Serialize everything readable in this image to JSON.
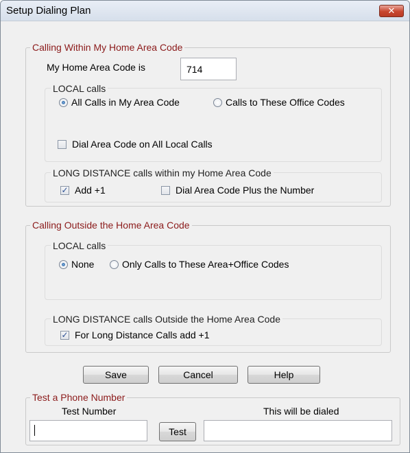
{
  "window": {
    "title": "Setup Dialing Plan",
    "close_glyph": "✕"
  },
  "home": {
    "legend": "Calling Within My Home Area Code",
    "area_code_label": "My Home Area Code is",
    "area_code_value": "714",
    "local": {
      "legend": "LOCAL calls",
      "radio_all": "All Calls in My Area Code",
      "radio_office": "Calls to These Office Codes",
      "selected": "all",
      "dial_area_code_label": "Dial Area Code on All Local Calls",
      "dial_area_code_checked": false
    },
    "long_distance": {
      "legend": "LONG DISTANCE calls within my Home Area Code",
      "add_plus1_label": "Add +1",
      "add_plus1_checked": true,
      "dial_area_plus_label": "Dial Area Code Plus the Number",
      "dial_area_plus_checked": false
    }
  },
  "outside": {
    "legend": "Calling Outside the Home Area Code",
    "local": {
      "legend": "LOCAL calls",
      "radio_none": "None",
      "radio_only": "Only Calls to These Area+Office Codes",
      "selected": "none"
    },
    "long_distance": {
      "legend": "LONG DISTANCE calls Outside the Home Area Code",
      "add_plus1_label": "For Long Distance Calls add +1",
      "add_plus1_checked": true
    }
  },
  "buttons": {
    "save": "Save",
    "cancel": "Cancel",
    "help": "Help"
  },
  "test": {
    "legend": "Test a Phone Number",
    "test_number_label": "Test Number",
    "test_number_value": "",
    "test_button": "Test",
    "dialed_label": "This will be dialed",
    "dialed_value": ""
  },
  "colors": {
    "legend_red": "#8b1a1a",
    "close_button": "#c8462f"
  }
}
